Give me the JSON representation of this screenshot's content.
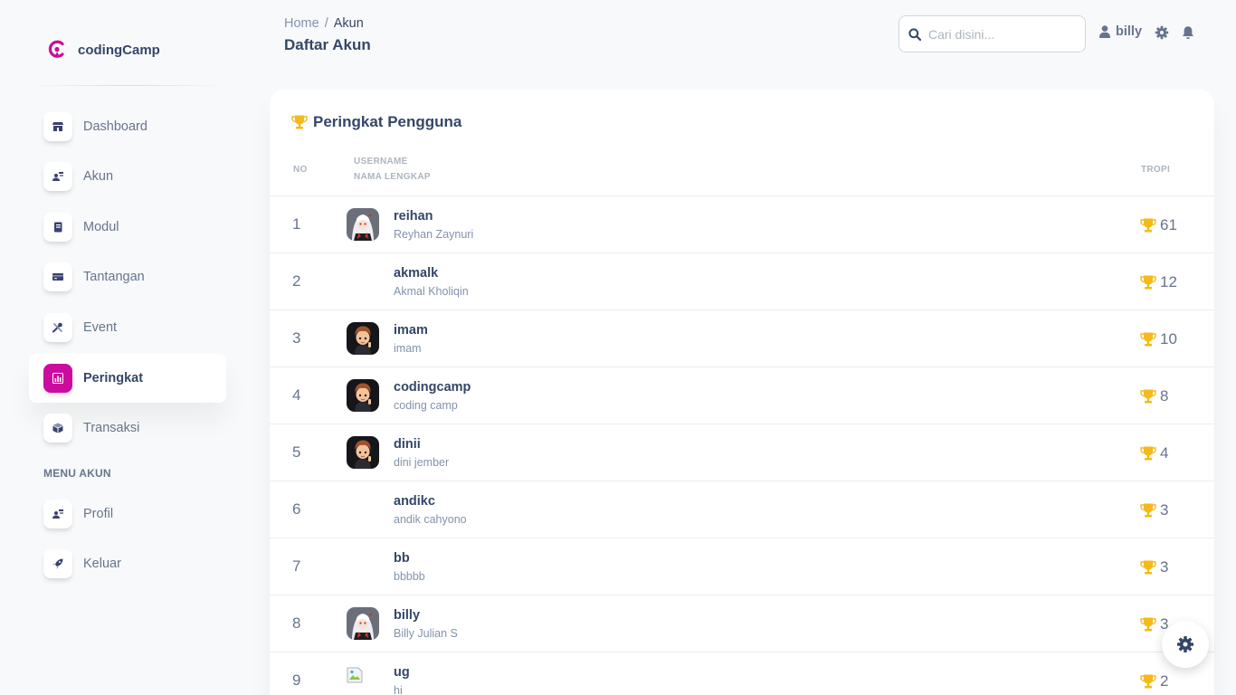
{
  "brand": {
    "name": "codingCamp"
  },
  "sidebar": {
    "items": [
      {
        "label": "Dashboard",
        "icon": "shop-icon"
      },
      {
        "label": "Akun",
        "icon": "user-card-icon"
      },
      {
        "label": "Modul",
        "icon": "book-icon"
      },
      {
        "label": "Tantangan",
        "icon": "credit-card-icon"
      },
      {
        "label": "Event",
        "icon": "tools-icon"
      },
      {
        "label": "Peringkat",
        "icon": "chart-icon",
        "active": true
      },
      {
        "label": "Transaksi",
        "icon": "box-icon"
      }
    ],
    "section_title": "MENU AKUN",
    "account_items": [
      {
        "label": "Profil",
        "icon": "user-card-icon"
      },
      {
        "label": "Keluar",
        "icon": "rocket-icon"
      }
    ]
  },
  "header": {
    "breadcrumb_home": "Home",
    "breadcrumb_sep": "/",
    "breadcrumb_current": "Akun",
    "title": "Daftar Akun",
    "search_placeholder": "Cari disini...",
    "username": "billy"
  },
  "card": {
    "title": "Peringkat Pengguna",
    "columns": {
      "no": "NO",
      "username": "USERNAME",
      "fullname": "NAMA LENGKAP",
      "trophy": "TROPI"
    }
  },
  "rows": [
    {
      "no": "1",
      "username": "reihan",
      "fullname": "Reyhan Zaynuri",
      "trophies": "61",
      "avatar": "anime-white"
    },
    {
      "no": "2",
      "username": "akmalk",
      "fullname": "Akmal Kholiqin",
      "trophies": "12",
      "avatar": "none"
    },
    {
      "no": "3",
      "username": "imam",
      "fullname": "imam",
      "trophies": "10",
      "avatar": "boy"
    },
    {
      "no": "4",
      "username": "codingcamp",
      "fullname": "coding camp",
      "trophies": "8",
      "avatar": "boy"
    },
    {
      "no": "5",
      "username": "dinii",
      "fullname": "dini jember",
      "trophies": "4",
      "avatar": "boy"
    },
    {
      "no": "6",
      "username": "andikc",
      "fullname": "andik cahyono",
      "trophies": "3",
      "avatar": "none"
    },
    {
      "no": "7",
      "username": "bb",
      "fullname": "bbbbb",
      "trophies": "3",
      "avatar": "none"
    },
    {
      "no": "8",
      "username": "billy",
      "fullname": "Billy Julian S",
      "trophies": "3",
      "avatar": "anime-white"
    },
    {
      "no": "9",
      "username": "ug",
      "fullname": "hi",
      "trophies": "2",
      "avatar": "broken"
    }
  ],
  "colors": {
    "accent": "#cb0c9f",
    "trophy": "#f5b919",
    "text": "#344767",
    "muted": "#67748e"
  }
}
